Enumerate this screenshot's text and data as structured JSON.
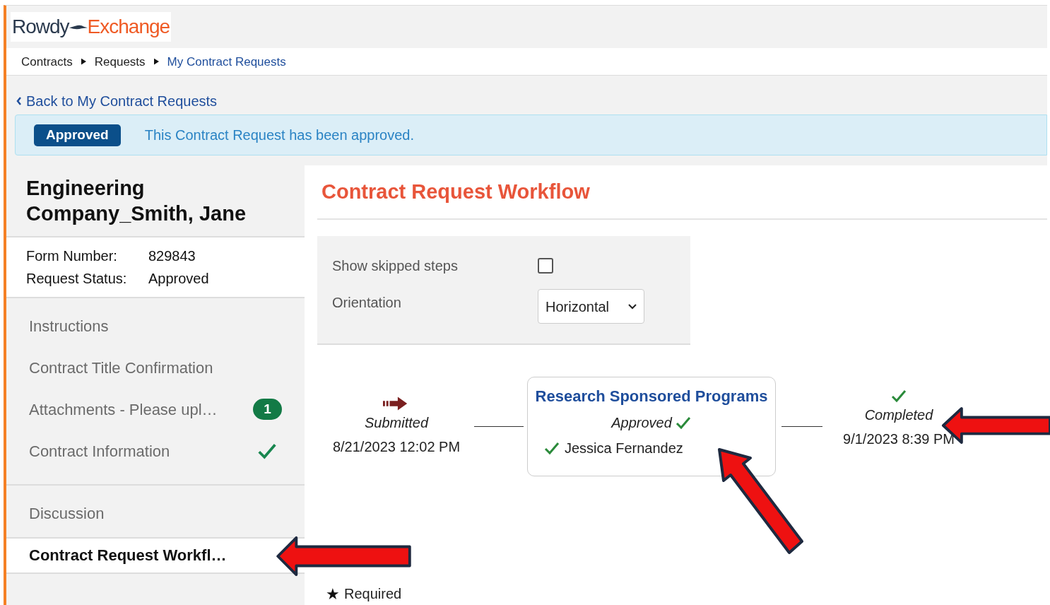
{
  "logo": {
    "left": "Rowdy",
    "right": "Exchange"
  },
  "breadcrumb": [
    {
      "label": "Contracts",
      "current": false
    },
    {
      "label": "Requests",
      "current": false
    },
    {
      "label": "My Contract Requests",
      "current": true
    }
  ],
  "back_link": "Back to My Contract Requests",
  "alert": {
    "badge": "Approved",
    "message": "This Contract Request has been approved."
  },
  "record": {
    "title": "Engineering Company_Smith, Jane",
    "fields": [
      {
        "label": "Form Number:",
        "value": "829843"
      },
      {
        "label": "Request Status:",
        "value": "Approved"
      }
    ]
  },
  "nav_sections": [
    [
      {
        "label": "Instructions",
        "selected": false,
        "complete": false
      },
      {
        "label": "Contract Title Confirmation",
        "selected": false,
        "complete": false
      },
      {
        "label": "Attachments - Please upl…",
        "selected": false,
        "complete": false,
        "badge": "1"
      },
      {
        "label": "Contract Information",
        "selected": false,
        "complete": true
      }
    ],
    [
      {
        "label": "Discussion",
        "selected": false,
        "complete": false
      },
      {
        "label": "Contract Request Workfl…",
        "selected": true,
        "complete": false
      }
    ]
  ],
  "workflow": {
    "title": "Contract Request Workflow",
    "show_skipped": {
      "label": "Show skipped steps",
      "checked": false
    },
    "orientation": {
      "label": "Orientation",
      "value": "Horizontal"
    },
    "steps": [
      {
        "kind": "start",
        "status": "Submitted",
        "date": "8/21/2023 12:02 PM"
      },
      {
        "kind": "group",
        "title": "Research Sponsored Programs",
        "status": "Approved",
        "approver": "Jessica Fernandez"
      },
      {
        "kind": "end",
        "status": "Completed",
        "date": "9/1/2023 8:39 PM"
      }
    ]
  },
  "required": {
    "mark": "★",
    "label": "Required"
  }
}
